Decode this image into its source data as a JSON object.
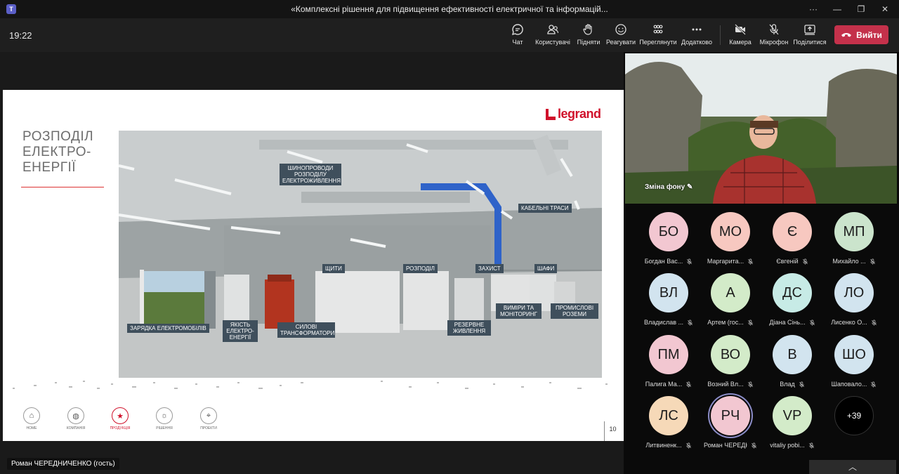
{
  "window": {
    "title": "«Комплексні рішення для підвищення ефективності електричної та інформацій...",
    "icon": "teams-icon"
  },
  "toolbar": {
    "time": "19:22",
    "items": [
      {
        "label": "Чат",
        "icon": "chat-icon"
      },
      {
        "label": "Користувачі",
        "icon": "people-icon"
      },
      {
        "label": "Підняти",
        "icon": "raise-hand-icon"
      },
      {
        "label": "Реагувати",
        "icon": "smile-icon"
      },
      {
        "label": "Переглянути",
        "icon": "view-icon"
      },
      {
        "label": "Додатково",
        "icon": "more-icon"
      },
      {
        "label": "Камера",
        "icon": "camera-off-icon"
      },
      {
        "label": "Мікрофон",
        "icon": "mic-off-icon"
      },
      {
        "label": "Поділитися",
        "icon": "share-icon"
      }
    ],
    "leave": "Вийти"
  },
  "slide": {
    "title": [
      "РОЗПОДІЛ",
      "ЕЛЕКТРО-",
      "ЕНЕРГІЇ"
    ],
    "logo": "legrand",
    "page": "10",
    "tags": [
      "ШИНОПРОВОДИ РОЗПОДІЛУ ЕЛЕКТРОЖИВЛЕННЯ",
      "КАБЕЛЬНІ ТРАСИ",
      "ЩИТИ",
      "РОЗПОДІЛ",
      "ЗАХИСТ",
      "ШАФИ",
      "ЗАРЯДКА ЕЛЕКТРОМОБІЛІВ",
      "ЯКІСТЬ ЕЛЕКТРО-ЕНЕРГІЇ",
      "СИЛОВІ ТРАНСФОРМАТОРИ",
      "РЕЗЕРВНЕ ЖИВЛЕННЯ",
      "ВИМІРИ ТА МОНІТОРИНГ",
      "ПРОМИСЛОВІ РОЗЕМИ"
    ],
    "nav": [
      "HOME",
      "КОМПАНІЯ",
      "ПРОДУКЦІЯ",
      "РІШЕННЯ",
      "ПРОЕКТИ"
    ]
  },
  "presenter_label": "Роман ЧЕРЕДНИЧЕНКО (гость)",
  "video": {
    "background_label": "Зміна фону"
  },
  "participants": [
    {
      "initials": "БО",
      "name": "Богдан Вас...",
      "color": "#f2c7d1"
    },
    {
      "initials": "МО",
      "name": "Маргарита...",
      "color": "#f7c8c0"
    },
    {
      "initials": "Є",
      "name": "Євгеній",
      "color": "#f7c8c0"
    },
    {
      "initials": "МП",
      "name": "Михайло ...",
      "color": "#cbe4cc"
    },
    {
      "initials": "ВЛ",
      "name": "Владислав ...",
      "color": "#d2e4ef"
    },
    {
      "initials": "А",
      "name": "Артем (гос...",
      "color": "#d3ebc9"
    },
    {
      "initials": "ДС",
      "name": "Діана Сінь...",
      "color": "#c7ebe6"
    },
    {
      "initials": "ЛО",
      "name": "Лисенко О...",
      "color": "#d2e4ef"
    },
    {
      "initials": "ПМ",
      "name": "Палига Ма...",
      "color": "#f2c7d1"
    },
    {
      "initials": "ВО",
      "name": "Возний Вл...",
      "color": "#d3ebc9"
    },
    {
      "initials": "В",
      "name": "Влад",
      "color": "#d2e4ef"
    },
    {
      "initials": "ШО",
      "name": "Шаповало...",
      "color": "#d2e4ef"
    },
    {
      "initials": "ЛС",
      "name": "Литвиненк...",
      "color": "#f6d9b8"
    },
    {
      "initials": "РЧ",
      "name": "Роман ЧЕРЕДН...",
      "color": "#f2c7d1"
    },
    {
      "initials": "VP",
      "name": "vitaliy pobi...",
      "color": "#d3ebc9"
    },
    {
      "initials": "+39",
      "name": "",
      "color": "#000000"
    }
  ]
}
